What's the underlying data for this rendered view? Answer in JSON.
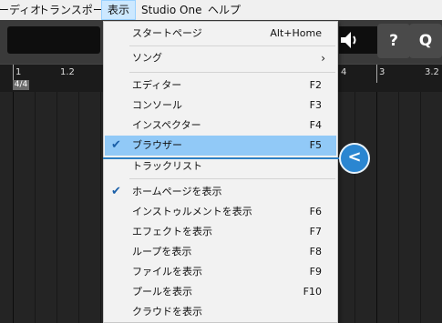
{
  "menubar": {
    "items": [
      {
        "label": "ーディオ"
      },
      {
        "label": "トランスポート"
      },
      {
        "label": "表示"
      },
      {
        "label": "Studio One"
      },
      {
        "label": "ヘルプ"
      }
    ]
  },
  "toolbar": {
    "speaker_icon": "speaker-icon",
    "help_label": "?",
    "search_label": "Q"
  },
  "ruler": {
    "marks": [
      "1",
      "1.2",
      "4",
      "3",
      "3.2"
    ],
    "time_signature": "4/4"
  },
  "menu": {
    "items": [
      {
        "label": "スタートページ",
        "shortcut": "Alt+Home",
        "checked": false
      },
      {
        "label": "ソング",
        "shortcut": "",
        "submenu": "›"
      },
      {
        "label": "エディター",
        "shortcut": "F2"
      },
      {
        "label": "コンソール",
        "shortcut": "F3"
      },
      {
        "label": "インスペクター",
        "shortcut": "F4"
      },
      {
        "label": "ブラウザー",
        "shortcut": "F5",
        "checked": true
      },
      {
        "label": "トラックリスト",
        "shortcut": ""
      },
      {
        "label": "ホームページを表示",
        "shortcut": "",
        "checked": true
      },
      {
        "label": "インストゥルメントを表示",
        "shortcut": "F6"
      },
      {
        "label": "エフェクトを表示",
        "shortcut": "F7"
      },
      {
        "label": "ループを表示",
        "shortcut": "F8"
      },
      {
        "label": "ファイルを表示",
        "shortcut": "F9"
      },
      {
        "label": "プールを表示",
        "shortcut": "F10"
      },
      {
        "label": "クラウドを表示",
        "shortcut": ""
      }
    ],
    "check_glyph": "✔"
  },
  "pointer": {
    "glyph": "<"
  },
  "colors": {
    "highlight": "#91c9f7",
    "check": "#1a5fa8",
    "pointer": "#2a86d1"
  }
}
